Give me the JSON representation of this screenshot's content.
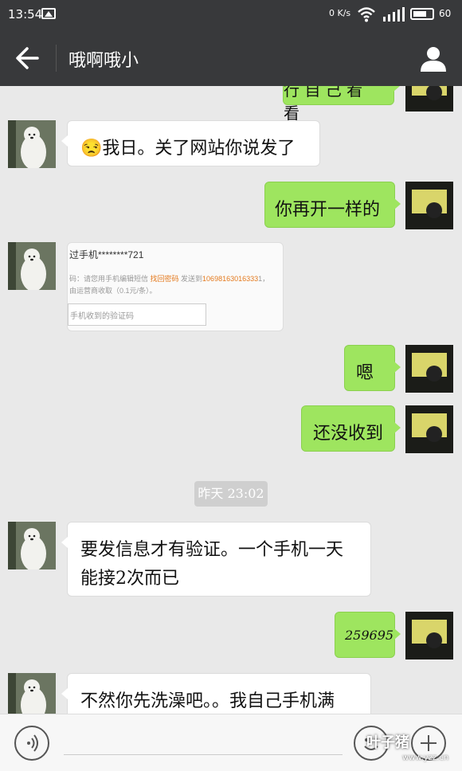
{
  "status_bar": {
    "time": "13:54",
    "net_speed": "0 K/s",
    "battery": "60"
  },
  "header": {
    "title": "哦啊哦小"
  },
  "messages": [
    {
      "side": "right",
      "text": "行 自 己 看 看",
      "partial": true
    },
    {
      "side": "left",
      "text": "😒我日。关了网站你说发了"
    },
    {
      "side": "right",
      "text": "你再开一样的"
    },
    {
      "side": "left",
      "type": "image",
      "image_text": {
        "line1": "过手机********721",
        "line2_prefix": "码：请您用手机编辑短信 ",
        "line2_highlight": "找回密码",
        "line2_mid": " 发送到",
        "line2_number": "10698163016333",
        "line2_suffix": "1，",
        "line3": "由运营商收取（0.1元/条）。",
        "placeholder": "手机收到的验证码"
      }
    },
    {
      "side": "right",
      "text": "嗯"
    },
    {
      "side": "right",
      "text": "还没收到"
    },
    {
      "type": "timestamp",
      "text": "昨天 23:02"
    },
    {
      "side": "left",
      "text_line1": "要发信息才有验证。一个手机一天",
      "text_line2": "能接2次而已"
    },
    {
      "side": "right",
      "text": "259695"
    },
    {
      "side": "left",
      "text": "不然你先洗澡吧。。我自己手机满"
    }
  ],
  "watermark": {
    "text": "叶子猪",
    "sub": "www.yzz.cn"
  },
  "colors": {
    "header_bg": "#38393b",
    "chat_bg": "#e9e9e9",
    "green_bubble": "#9ee55f",
    "white_bubble": "#ffffff"
  }
}
